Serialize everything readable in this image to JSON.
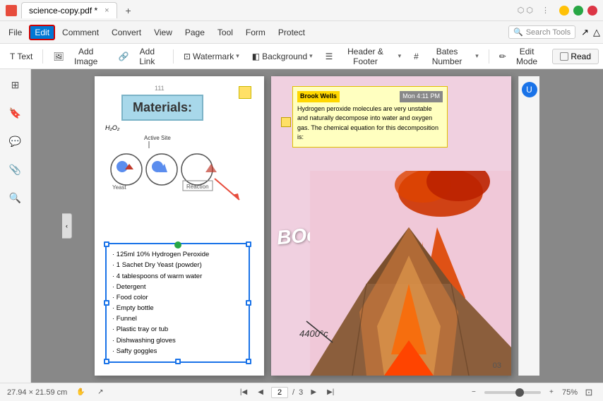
{
  "titleBar": {
    "appName": "science-copy.pdf *",
    "closeLabel": "×",
    "minLabel": "−",
    "maxLabel": "□",
    "newTabLabel": "+"
  },
  "menuBar": {
    "items": [
      "File",
      "Edit",
      "Comment",
      "Convert",
      "View",
      "Page",
      "Tool",
      "Form",
      "Protect"
    ],
    "activeItem": "Edit",
    "searchPlaceholder": "Search Tools"
  },
  "toolbar": {
    "textLabel": "Text",
    "addImageLabel": "Add Image",
    "addLinkLabel": "Add Link",
    "watermarkLabel": "Watermark",
    "backgroundLabel": "Background",
    "headerFooterLabel": "Header & Footer",
    "batesNumberLabel": "Bates Number",
    "editModeLabel": "Edit Mode",
    "readLabel": "Read"
  },
  "leftSidebar": {
    "icons": [
      "pages-icon",
      "bookmarks-icon",
      "comments-icon",
      "attachments-icon",
      "search-icon"
    ]
  },
  "pageContent": {
    "left": {
      "title": "Materials:",
      "h2o2": "H₂O₂",
      "activeSite": "Active Site",
      "yeast": "Yeast",
      "reaction": "Reaction",
      "ingredients": [
        "125ml 10% Hydrogen Peroxide",
        "1 Sachet Dry Yeast (powder)",
        "4 tablespoons of warm water",
        "Detergent",
        "Food color",
        "Empty bottle",
        "Funnel",
        "Plastic tray or tub",
        "Dishwashing gloves",
        "Safty goggles"
      ]
    },
    "right": {
      "author": "Brook Wells",
      "time": "Mon 4:11 PM",
      "annotationText": "Hydrogen peroxide molecules are very unstable and naturally decompose into water and oxygen gas. The chemical equation for this decomposition is:",
      "boomText": "BOoooom!",
      "tempLabel": "4400°c",
      "pageNumber": "03"
    }
  },
  "statusBar": {
    "dimensions": "27.94 × 21.59 cm",
    "pageIndicator": "2 / 3",
    "zoomPercent": "75%"
  }
}
